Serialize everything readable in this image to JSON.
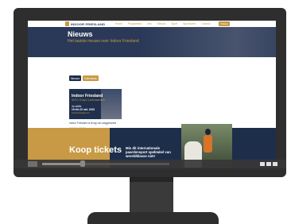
{
  "site": {
    "logo_text": "INDOOR FRIESLAND",
    "nav": [
      "Home",
      "Programma",
      "Info",
      "Nieuws",
      "Sport",
      "Sponsoren",
      "Contact"
    ],
    "cta_label": "Tickets"
  },
  "hero": {
    "title": "Nieuws",
    "subtitle": "Het laatste nieuws over Indoor Friesland"
  },
  "tabs": {
    "active": "Nieuws",
    "inactive": "Interviews"
  },
  "card": {
    "image_title": "Indoor Friesland",
    "image_subtitle": "WTC Expo Leeuwarden",
    "image_edition": "4e editie",
    "image_dates": "19 t/m 22 okt. 2023",
    "image_site": "indoorfriesland.nl",
    "title": "Indoor Friesland is terug van weggeweest",
    "meta": "2 dagen geleden"
  },
  "promo": {
    "left_text": "Koop tickets",
    "right_text": "Mis dit internationale paardensport spektakel van wereldklasse niet!"
  },
  "video": {
    "progress": 0.3
  },
  "colors": {
    "navy": "#1d2e4a",
    "gold": "#c89a45",
    "monitor": "#2e2e2e"
  }
}
